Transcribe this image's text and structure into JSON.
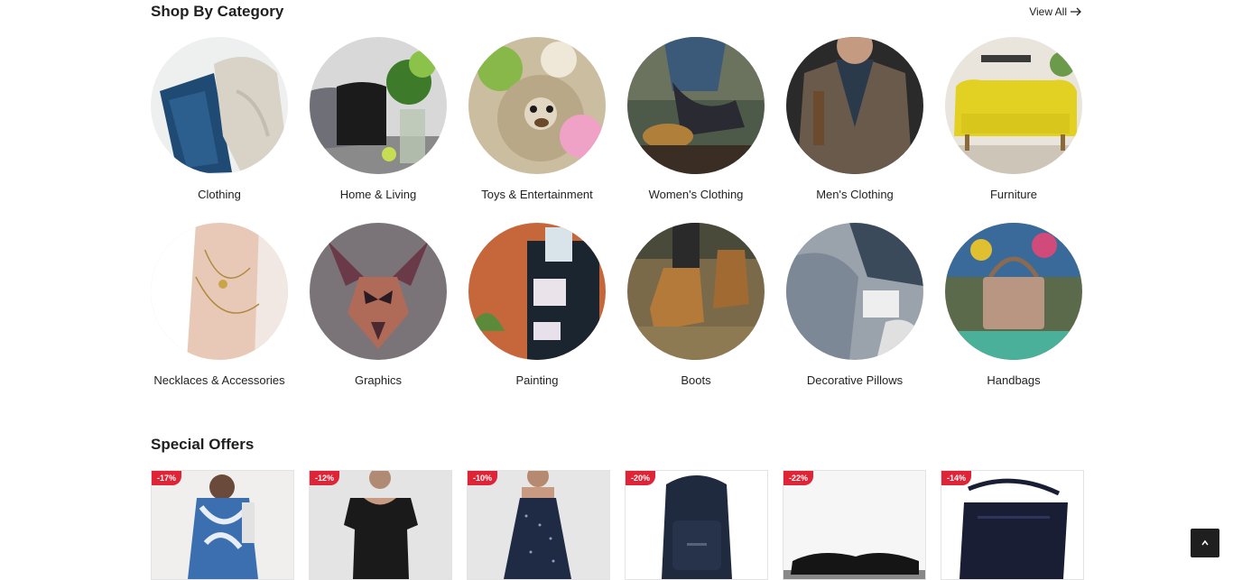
{
  "shop_by_category": {
    "title": "Shop By Category",
    "view_all": "View All",
    "categories": [
      {
        "label": "Clothing"
      },
      {
        "label": "Home & Living"
      },
      {
        "label": "Toys & Entertainment"
      },
      {
        "label": "Women's Clothing"
      },
      {
        "label": "Men's Clothing"
      },
      {
        "label": "Furniture"
      },
      {
        "label": "Necklaces & Accessories"
      },
      {
        "label": "Graphics"
      },
      {
        "label": "Painting"
      },
      {
        "label": "Boots"
      },
      {
        "label": "Decorative Pillows"
      },
      {
        "label": "Handbags"
      }
    ]
  },
  "special_offers": {
    "title": "Special Offers",
    "products": [
      {
        "discount": "-17%"
      },
      {
        "discount": "-12%"
      },
      {
        "discount": "-10%"
      },
      {
        "discount": "-20%"
      },
      {
        "discount": "-22%"
      },
      {
        "discount": "-14%"
      }
    ]
  },
  "colors": {
    "badge": "#e02437",
    "scroll_top_bg": "#1f1f1f"
  }
}
